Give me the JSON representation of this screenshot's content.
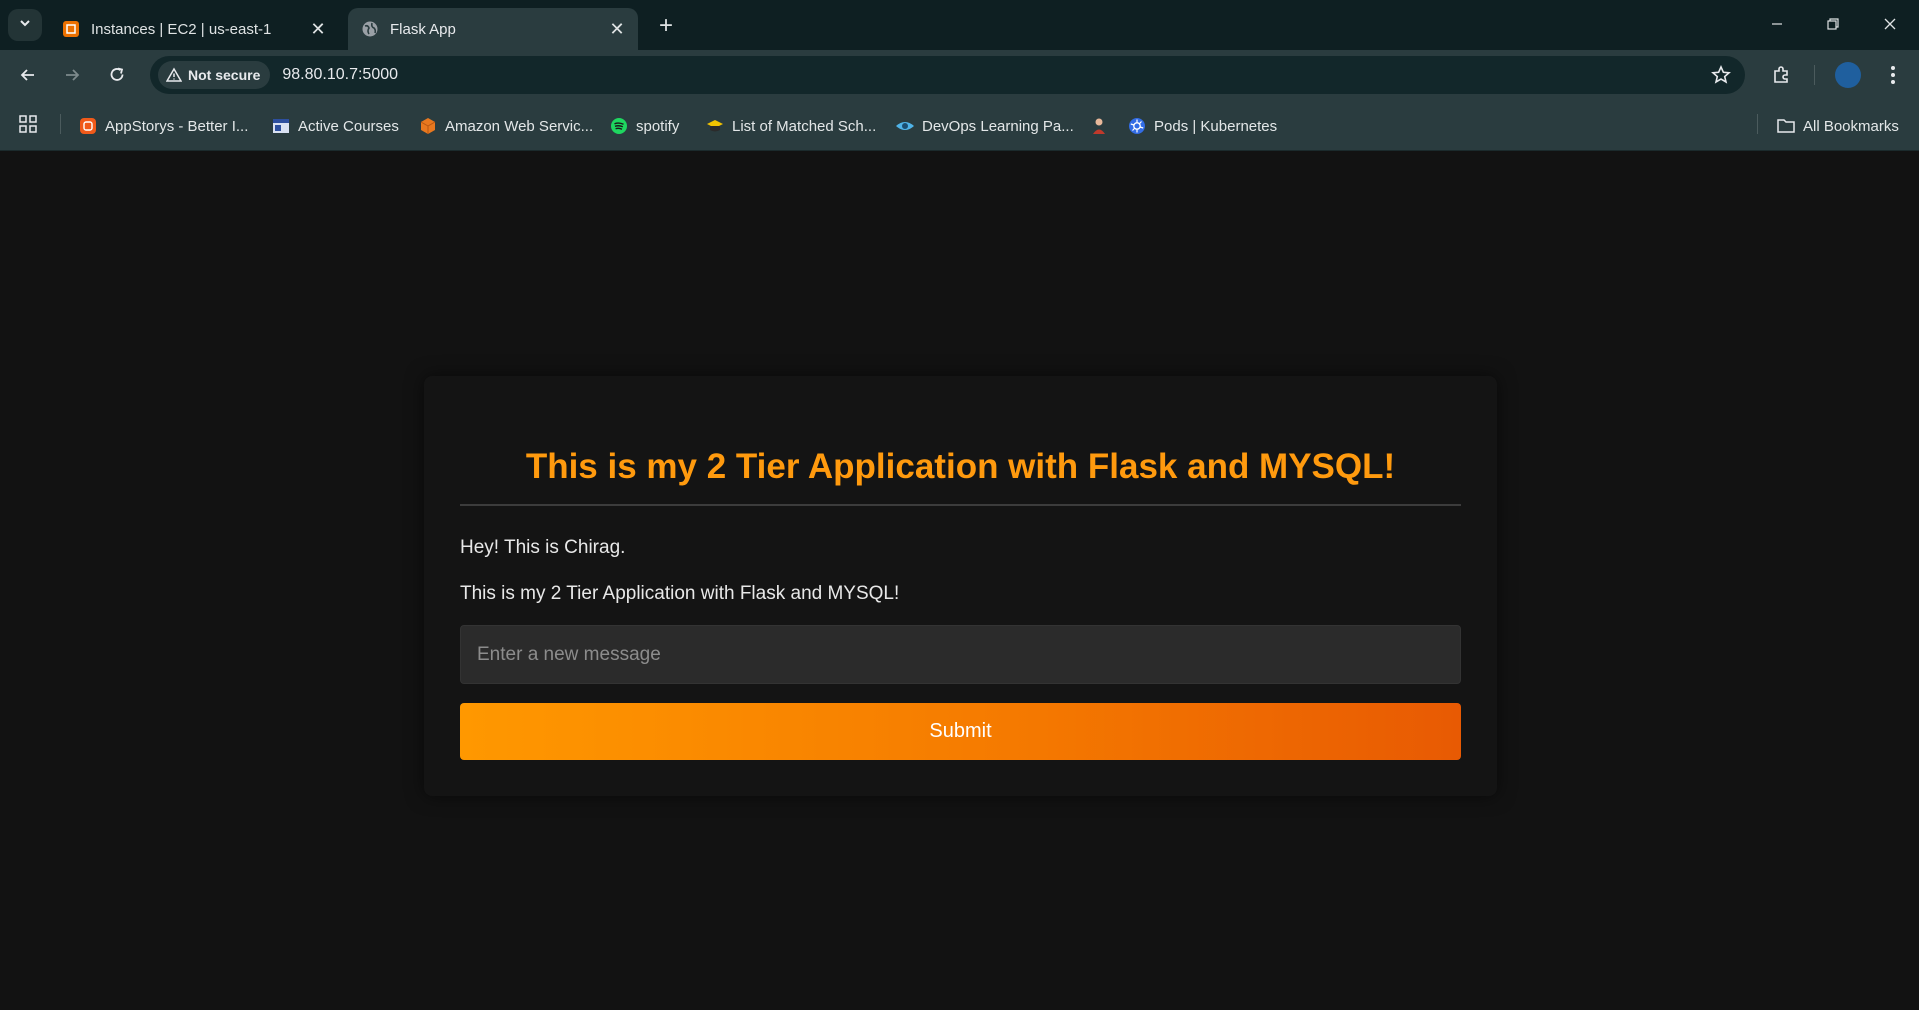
{
  "browser": {
    "tabs": [
      {
        "title": "Instances | EC2 | us-east-1",
        "icon": "aws-ec2-icon",
        "active": false
      },
      {
        "title": "Flask App",
        "icon": "globe-icon",
        "active": true
      }
    ],
    "address_bar": {
      "security_label": "Not secure",
      "url": "98.80.10.7:5000"
    },
    "bookmarks": [
      {
        "label": "AppStorys - Better I...",
        "icon": "appstorys-icon"
      },
      {
        "label": "Active Courses",
        "icon": "courses-icon"
      },
      {
        "label": "Amazon Web Servic...",
        "icon": "aws-icon"
      },
      {
        "label": "spotify",
        "icon": "spotify-icon"
      },
      {
        "label": "List of Matched Sch...",
        "icon": "graduation-icon"
      },
      {
        "label": "DevOps Learning Pa...",
        "icon": "eye-icon"
      },
      {
        "label": "",
        "icon": "person-icon"
      },
      {
        "label": "Pods | Kubernetes",
        "icon": "kubernetes-icon"
      }
    ],
    "all_bookmarks_label": "All Bookmarks"
  },
  "page": {
    "heading": "This is my 2 Tier Application with Flask and MYSQL!",
    "messages": [
      "Hey! This is Chirag.",
      "This is my 2 Tier Application with Flask and MYSQL!"
    ],
    "input_placeholder": "Enter a new message",
    "submit_label": "Submit"
  },
  "colors": {
    "heading": "#ff9a0e",
    "button_gradient_start": "#ff9800",
    "button_gradient_end": "#e85a03",
    "background": "#121212"
  }
}
